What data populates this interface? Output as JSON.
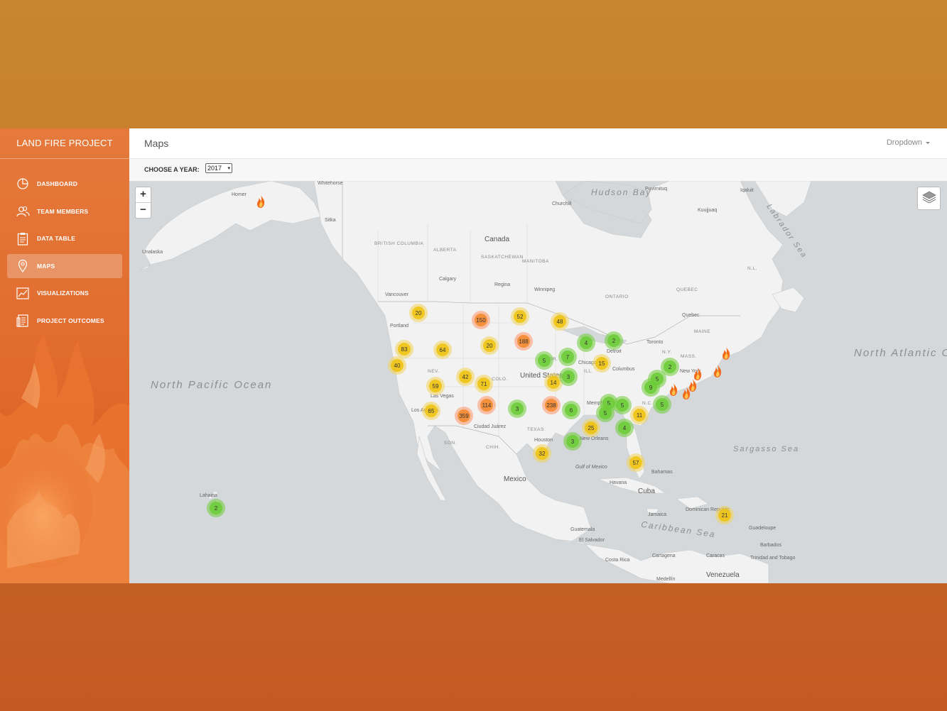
{
  "brand": "LAND FIRE PROJECT",
  "nav": [
    {
      "label": "DASHBOARD",
      "icon": "dashboard-icon",
      "active": false
    },
    {
      "label": "TEAM MEMBERS",
      "icon": "team-icon",
      "active": false
    },
    {
      "label": "DATA TABLE",
      "icon": "clipboard-icon",
      "active": false
    },
    {
      "label": "MAPS",
      "icon": "map-pin-icon",
      "active": true
    },
    {
      "label": "VISUALIZATIONS",
      "icon": "chart-icon",
      "active": false
    },
    {
      "label": "PROJECT OUTCOMES",
      "icon": "document-icon",
      "active": false
    }
  ],
  "header": {
    "title": "Maps",
    "dropdown_label": "Dropdown"
  },
  "filter": {
    "label": "CHOOSE A YEAR:",
    "selected_year": "2017"
  },
  "map": {
    "zoom_in": "+",
    "zoom_out": "−",
    "colors": {
      "small": "#6ecc39",
      "medium": "#f0c20c",
      "large": "#f18017"
    },
    "clusters": [
      {
        "count": "20",
        "size": "medium"
      },
      {
        "count": "150",
        "size": "large"
      },
      {
        "count": "52",
        "size": "medium"
      },
      {
        "count": "48",
        "size": "medium"
      },
      {
        "count": "83",
        "size": "medium"
      },
      {
        "count": "64",
        "size": "medium"
      },
      {
        "count": "20",
        "size": "medium"
      },
      {
        "count": "188",
        "size": "large"
      },
      {
        "count": "4",
        "size": "small"
      },
      {
        "count": "2",
        "size": "small"
      },
      {
        "count": "40",
        "size": "medium"
      },
      {
        "count": "5",
        "size": "small"
      },
      {
        "count": "7",
        "size": "small"
      },
      {
        "count": "15",
        "size": "medium"
      },
      {
        "count": "42",
        "size": "medium"
      },
      {
        "count": "71",
        "size": "medium"
      },
      {
        "count": "59",
        "size": "medium"
      },
      {
        "count": "14",
        "size": "medium"
      },
      {
        "count": "3",
        "size": "small"
      },
      {
        "count": "2",
        "size": "small"
      },
      {
        "count": "5",
        "size": "small"
      },
      {
        "count": "9",
        "size": "small"
      },
      {
        "count": "114",
        "size": "large"
      },
      {
        "count": "238",
        "size": "large"
      },
      {
        "count": "65",
        "size": "medium"
      },
      {
        "count": "359",
        "size": "large"
      },
      {
        "count": "3",
        "size": "small"
      },
      {
        "count": "6",
        "size": "small"
      },
      {
        "count": "5",
        "size": "small"
      },
      {
        "count": "5",
        "size": "small"
      },
      {
        "count": "5",
        "size": "small"
      },
      {
        "count": "11",
        "size": "medium"
      },
      {
        "count": "5",
        "size": "small"
      },
      {
        "count": "25",
        "size": "medium"
      },
      {
        "count": "4",
        "size": "small"
      },
      {
        "count": "3",
        "size": "small"
      },
      {
        "count": "32",
        "size": "medium"
      },
      {
        "count": "57",
        "size": "medium"
      },
      {
        "count": "2",
        "size": "small"
      },
      {
        "count": "21",
        "size": "medium"
      }
    ],
    "oceans": [
      "North Pacific Ocean",
      "North Atlantic Ocean"
    ],
    "seas": [
      "Hudson Bay",
      "Labrador Sea",
      "Sargasso Sea",
      "Caribbean Sea",
      "Gulf of Mexico"
    ],
    "countries": [
      "Canada",
      "United States",
      "Mexico",
      "Cuba",
      "Venezuela"
    ],
    "places": [
      "Calgary",
      "Regina",
      "Winnipeg",
      "Vancouver",
      "Portland",
      "Las Vegas",
      "Los Angeles",
      "Ciudad Juárez",
      "Houston",
      "New Orleans",
      "Memphis",
      "Chicago",
      "Detroit",
      "Toronto",
      "Columbus",
      "New York",
      "Quebec",
      "Churchill",
      "Bahamas",
      "Havana",
      "Jamaica",
      "Dominican Republic",
      "Guatemala",
      "El Salvador",
      "Costa Rica",
      "Cartagena",
      "Caracas",
      "Trinidad and Tobago",
      "Barbados",
      "Guadeloupe",
      "Medellín",
      "Lahaina",
      "Unalaska",
      "Homer",
      "Sitka",
      "Whitehorse",
      "Puvirnituq",
      "Kuujjuaq",
      "Iqaluit"
    ],
    "regions": [
      "BRITISH COLUMBIA",
      "ALBERTA",
      "SASKATCHEWAN",
      "MANITOBA",
      "ONTARIO",
      "QUEBEC",
      "NEV.",
      "COLO.",
      "TEXAS",
      "SON.",
      "CHIH.",
      "NEBR.",
      "ILL.",
      "N.C.",
      "MAINE",
      "N.L.",
      "N.Y.",
      "MASS."
    ]
  }
}
